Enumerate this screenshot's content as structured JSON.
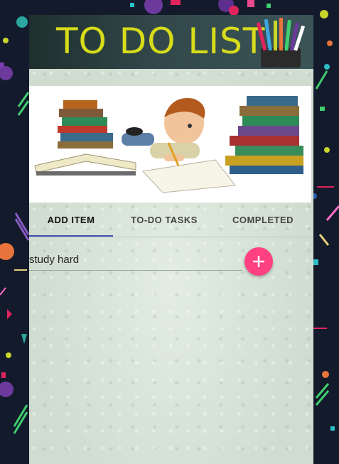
{
  "banner": {
    "title": "TO DO LIST"
  },
  "hero": {
    "image": "boy-doing-homework-with-books-illustration"
  },
  "tabs": [
    {
      "label": "ADD ITEM",
      "active": true
    },
    {
      "label": "TO-DO TASKS",
      "active": false
    },
    {
      "label": "COMPLETED",
      "active": false
    }
  ],
  "task_input": {
    "value": "study hard"
  },
  "add_button": {
    "icon": "plus-icon",
    "color": "#ff4081"
  },
  "colors": {
    "page_bg": "#131a2b",
    "accent": "#ff4081",
    "tab_indicator": "#3f51b5",
    "title": "#d7dc1a"
  }
}
